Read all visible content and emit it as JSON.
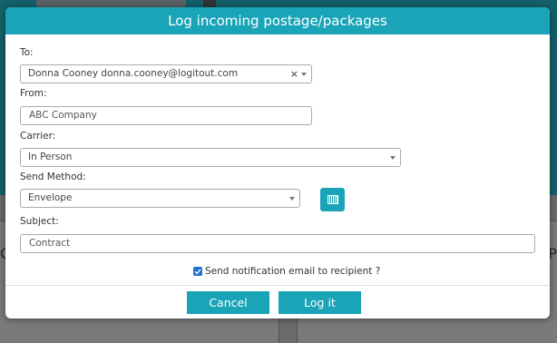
{
  "dialog": {
    "title": "Log incoming postage/packages"
  },
  "form": {
    "to": {
      "label": "To:",
      "value": "Donna Cooney donna.cooney@logitout.com",
      "clear_glyph": "×"
    },
    "from": {
      "label": "From:",
      "placeholder": "ABC Company"
    },
    "carrier": {
      "label": "Carrier:",
      "value": "In Person"
    },
    "send_method": {
      "label": "Send Method:",
      "value": "Envelope"
    },
    "subject": {
      "label": "Subject:",
      "placeholder": "Contract"
    },
    "notify": {
      "label": "Send notification email to recipient ?",
      "checked": true
    }
  },
  "footer": {
    "cancel_label": "Cancel",
    "submit_label": "Log it"
  },
  "background": {
    "left_edge_glyph": "C",
    "right_edge_glyph": "P"
  },
  "icons": {
    "barcode": "barcode-icon",
    "dropdown": "chevron-down-icon",
    "clear": "close-icon",
    "check": "check-icon"
  },
  "colors": {
    "accent": "#1aa4b8",
    "background_top": "#15606a",
    "overlay": "#6a6a6a"
  }
}
